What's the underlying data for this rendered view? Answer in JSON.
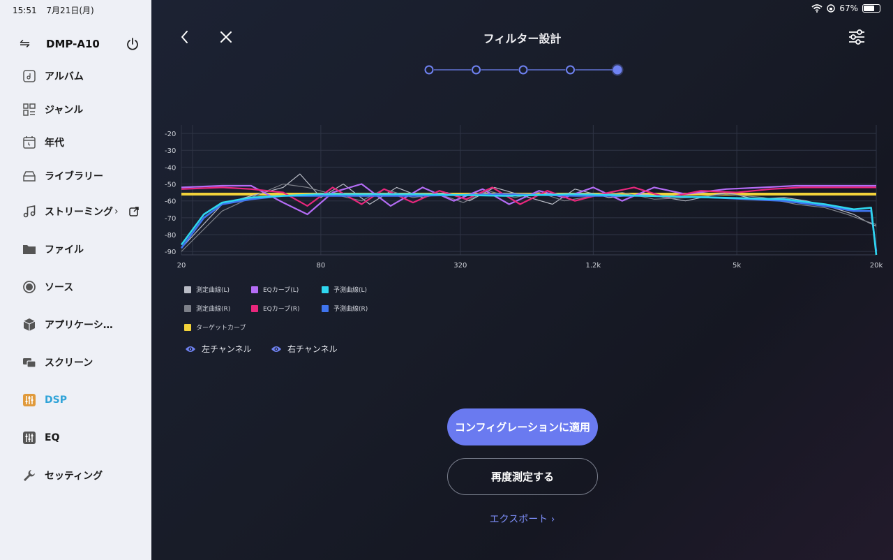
{
  "status": {
    "time": "15:51",
    "date": "7月21日(月)",
    "battery": "67%",
    "battery_level": 0.67
  },
  "sidebar": {
    "device_name": "DMP-A10",
    "items": [
      {
        "label": "アルバム",
        "icon": "album-icon"
      },
      {
        "label": "ジャンル",
        "icon": "genre-icon"
      },
      {
        "label": "年代",
        "icon": "calendar-icon"
      },
      {
        "label": "ライブラリー",
        "icon": "library-icon"
      },
      {
        "label": "ストリーミング",
        "icon": "music-note-icon"
      },
      {
        "label": "ファイル",
        "icon": "folder-icon"
      },
      {
        "label": "ソース",
        "icon": "source-icon"
      },
      {
        "label": "アプリケーシ…",
        "icon": "cube-icon"
      },
      {
        "label": "スクリーン",
        "icon": "screen-icon"
      },
      {
        "label": "DSP",
        "icon": "dsp-icon",
        "active": true
      },
      {
        "label": "EQ",
        "icon": "eq-icon"
      },
      {
        "label": "セッティング",
        "icon": "wrench-icon"
      }
    ],
    "streaming_chevron": "›",
    "active_color": "#2fa3d8"
  },
  "header": {
    "title": "フィルター設計"
  },
  "steps": {
    "total": 5,
    "current": 5
  },
  "legend": {
    "measured_l": "測定曲線(L)",
    "eq_l": "EQカーブ(L)",
    "predicted_l": "予測曲線(L)",
    "measured_r": "測定曲線(R)",
    "eq_r": "EQカーブ(R)",
    "predicted_r": "予測曲線(R)",
    "target": "ターゲットカーブ"
  },
  "channels": {
    "left": "左チャンネル",
    "right": "右チャンネル"
  },
  "buttons": {
    "apply": "コンフィグレーションに適用",
    "remeasure": "再度測定する",
    "export": "エクスポート ›"
  },
  "chart_data": {
    "type": "line",
    "x_scale": "log",
    "x_ticks": [
      "20",
      "80",
      "320",
      "1.2k",
      "5k",
      "20k"
    ],
    "x_tick_values": [
      20,
      80,
      320,
      1200,
      5000,
      20000
    ],
    "y_ticks": [
      "-20",
      "-30",
      "-40",
      "-50",
      "-60",
      "-70",
      "-80",
      "-90"
    ],
    "ylim": [
      -92,
      -15
    ],
    "grid": true,
    "series": [
      {
        "name": "測定曲線(L)",
        "color": "#b9bcc6",
        "x": [
          20,
          30,
          40,
          55,
          65,
          80,
          100,
          130,
          170,
          220,
          280,
          350,
          450,
          600,
          800,
          1000,
          1400,
          2000,
          3000,
          4500,
          6000,
          8000,
          10000,
          13000,
          16000,
          18000,
          20000
        ],
        "y": [
          -88,
          -62,
          -57,
          -52,
          -44,
          -58,
          -50,
          -62,
          -52,
          -58,
          -55,
          -60,
          -52,
          -57,
          -62,
          -53,
          -58,
          -56,
          -60,
          -55,
          -59,
          -58,
          -60,
          -64,
          -68,
          -72,
          -75
        ]
      },
      {
        "name": "測定曲線(R)",
        "color": "#7d8089",
        "x": [
          20,
          30,
          40,
          55,
          70,
          90,
          120,
          150,
          200,
          260,
          330,
          420,
          550,
          700,
          900,
          1200,
          1600,
          2200,
          3200,
          4500,
          6500,
          9000,
          12000,
          15000,
          18000,
          20000
        ],
        "y": [
          -90,
          -66,
          -58,
          -50,
          -52,
          -56,
          -60,
          -53,
          -58,
          -56,
          -61,
          -54,
          -58,
          -55,
          -60,
          -57,
          -55,
          -59,
          -58,
          -56,
          -58,
          -62,
          -64,
          -68,
          -72,
          -74
        ]
      },
      {
        "name": "EQカーブ(L)",
        "color": "#b46cf5",
        "x": [
          20,
          30,
          40,
          55,
          70,
          90,
          120,
          160,
          220,
          300,
          400,
          520,
          700,
          900,
          1200,
          1600,
          2200,
          3000,
          4500,
          6500,
          9000,
          20000
        ],
        "y": [
          -52,
          -51,
          -51,
          -61,
          -68,
          -55,
          -50,
          -63,
          -52,
          -60,
          -53,
          -62,
          -54,
          -58,
          -52,
          -60,
          -52,
          -56,
          -53,
          -52,
          -51,
          -51
        ]
      },
      {
        "name": "EQカーブ(R)",
        "color": "#e8277c",
        "x": [
          20,
          30,
          40,
          55,
          70,
          90,
          120,
          150,
          200,
          260,
          340,
          440,
          580,
          760,
          1000,
          1300,
          1800,
          2500,
          3500,
          5000,
          7000,
          9500,
          20000
        ],
        "y": [
          -53,
          -52,
          -53,
          -55,
          -63,
          -52,
          -62,
          -53,
          -61,
          -54,
          -59,
          -52,
          -62,
          -54,
          -60,
          -56,
          -52,
          -58,
          -54,
          -55,
          -53,
          -52,
          -52
        ]
      },
      {
        "name": "予測曲線(L)",
        "color": "#2fd6ee",
        "x": [
          20,
          25,
          30,
          40,
          55,
          80,
          200,
          500,
          1000,
          2000,
          4000,
          8000,
          12000,
          16000,
          19000,
          20000
        ],
        "y": [
          -86,
          -68,
          -61,
          -58,
          -57,
          -56,
          -56,
          -57,
          -56,
          -57,
          -58,
          -59,
          -62,
          -65,
          -64,
          -92
        ]
      },
      {
        "name": "予測曲線(R)",
        "color": "#3f74ee",
        "x": [
          20,
          25,
          30,
          40,
          55,
          80,
          200,
          500,
          1000,
          2000,
          4000,
          8000,
          12000,
          16000,
          19000,
          20000
        ],
        "y": [
          -88,
          -70,
          -62,
          -59,
          -57,
          -57,
          -57,
          -56,
          -57,
          -57,
          -58,
          -60,
          -63,
          -66,
          -66,
          -90
        ]
      },
      {
        "name": "ターゲットカーブ",
        "color": "#f2d23a",
        "x": [
          20,
          20000
        ],
        "y": [
          -56,
          -56
        ]
      }
    ]
  }
}
